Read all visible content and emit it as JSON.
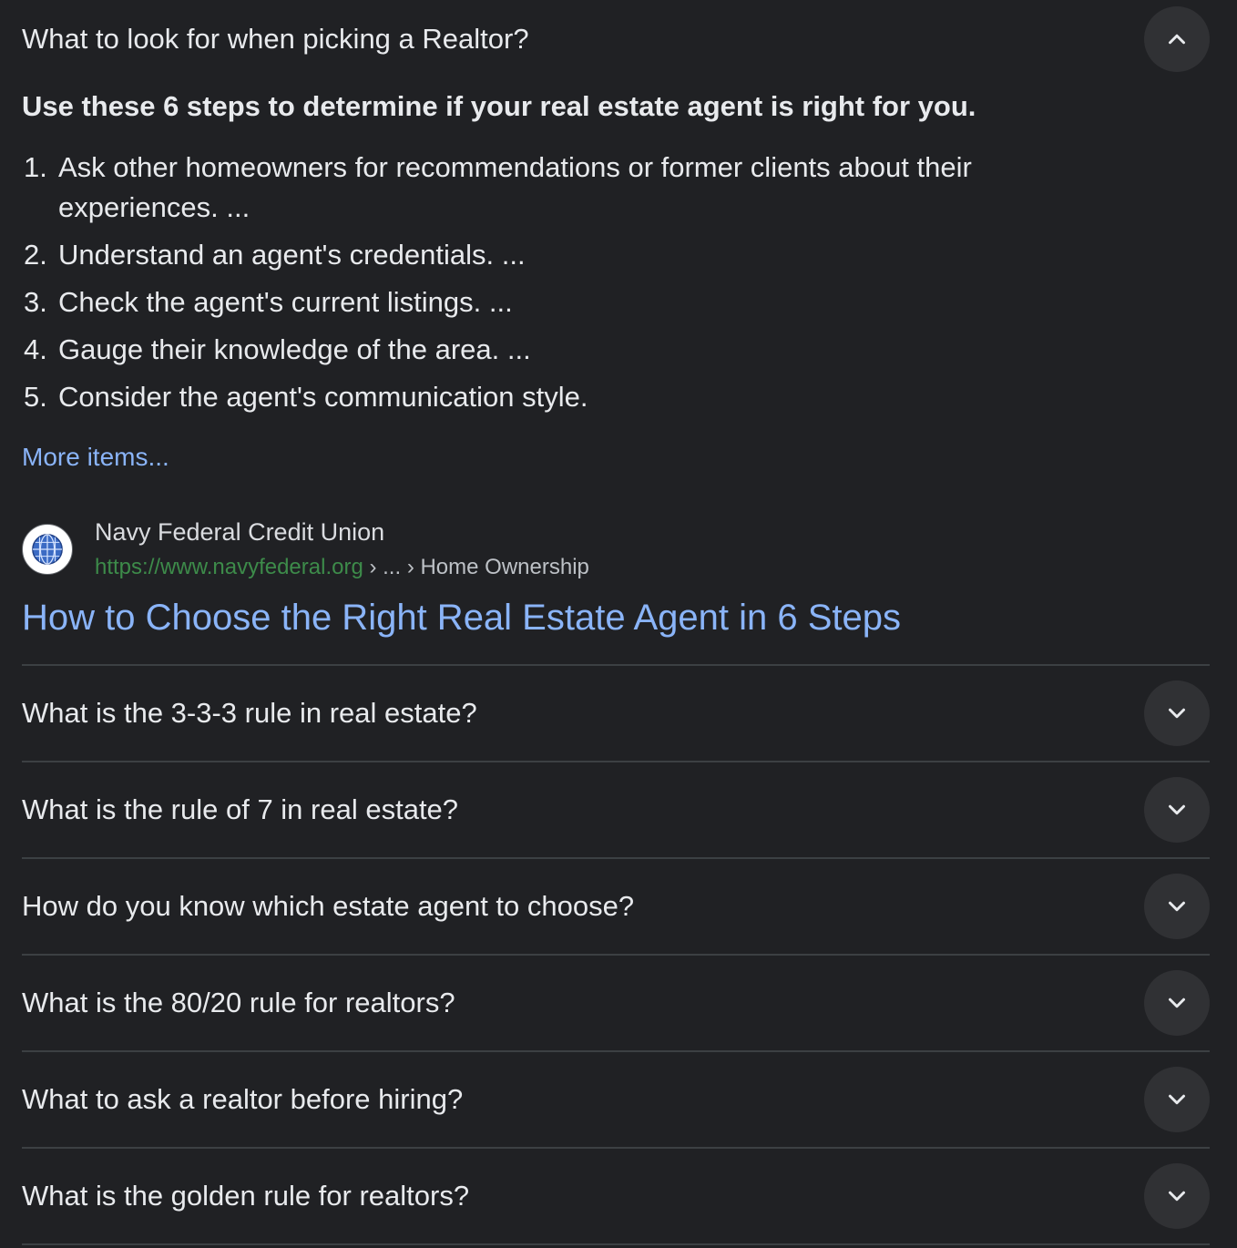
{
  "expanded": {
    "question": "What to look for when picking a Realtor?",
    "toggle_icon": "chevron-up-icon",
    "answer_heading": "Use these 6 steps to determine if your real estate agent is right for you.",
    "steps": [
      {
        "num": "1.",
        "text": "Ask other homeowners for recommendations or former clients about their experiences. ..."
      },
      {
        "num": "2.",
        "text": "Understand an agent's credentials. ..."
      },
      {
        "num": "3.",
        "text": "Check the agent's current listings. ..."
      },
      {
        "num": "4.",
        "text": "Gauge their knowledge of the area. ..."
      },
      {
        "num": "5.",
        "text": "Consider the agent's communication style."
      }
    ],
    "more_items": "More items...",
    "source": {
      "site_name": "Navy Federal Credit Union",
      "url": "https://www.navyfederal.org",
      "breadcrumb": " › ... › Home Ownership",
      "favicon": "globe-icon"
    },
    "result_title": "How to Choose the Right Real Estate Agent in 6 Steps"
  },
  "related_questions": [
    {
      "question": "What is the 3-3-3 rule in real estate?",
      "icon": "chevron-down-icon"
    },
    {
      "question": "What is the rule of 7 in real estate?",
      "icon": "chevron-down-icon"
    },
    {
      "question": "How do you know which estate agent to choose?",
      "icon": "chevron-down-icon"
    },
    {
      "question": "What is the 80/20 rule for realtors?",
      "icon": "chevron-down-icon"
    },
    {
      "question": "What to ask a realtor before hiring?",
      "icon": "chevron-down-icon"
    },
    {
      "question": "What is the golden rule for realtors?",
      "icon": "chevron-down-icon"
    }
  ],
  "colors": {
    "background": "#202124",
    "text": "#e8eaed",
    "link": "#8ab4f8",
    "url_green": "#3d8b4a",
    "divider": "#3c4043",
    "button_bg": "#303134"
  }
}
